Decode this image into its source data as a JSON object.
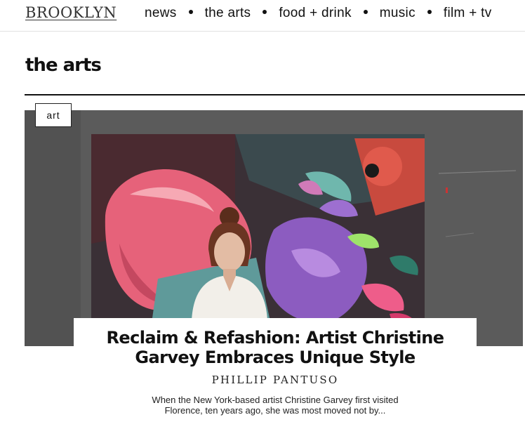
{
  "header": {
    "logo": "BROOKLYN",
    "nav": [
      "news",
      "the arts",
      "food + drink",
      "music",
      "film + tv"
    ]
  },
  "section": {
    "title": "the arts"
  },
  "feature": {
    "tag": "art",
    "headline_line1": "Reclaim & Refashion: Artist Christine",
    "headline_line2": "Garvey Embraces Unique Style",
    "byline": "PHILLIP PANTUSO",
    "excerpt": "When the New York-based artist Christine Garvey first visited Florence, ten years ago, she was most moved not by..."
  },
  "colors": {
    "wall": "#585858",
    "rule": "#111111",
    "painting_pink": "#e6627a",
    "painting_teal": "#5f9a9a",
    "painting_purple": "#8c5cc0"
  }
}
